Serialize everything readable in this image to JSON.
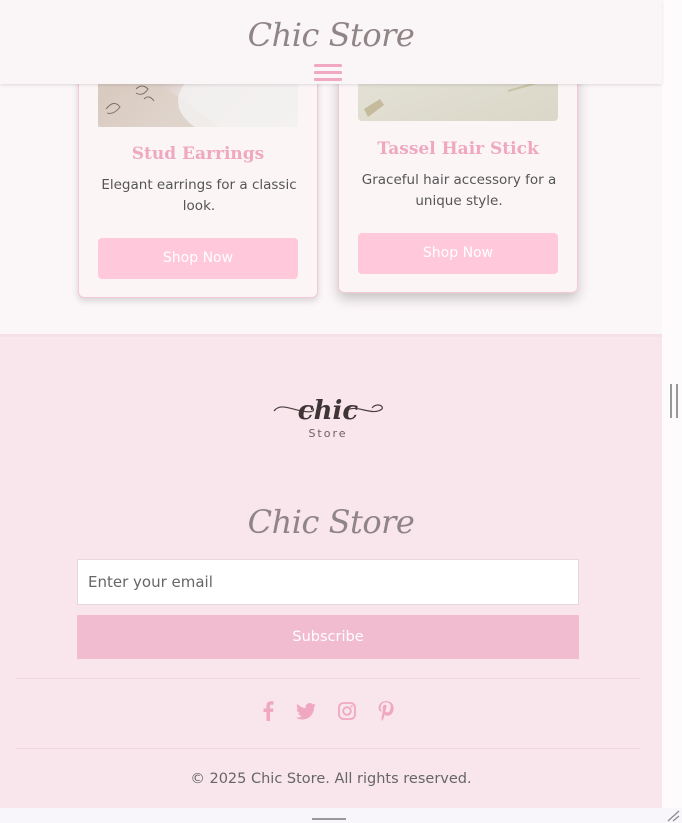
{
  "header": {
    "logo_text": "Chic Store",
    "menu_icon": "hamburger-menu-icon"
  },
  "products": [
    {
      "name": "Stud Earrings",
      "description": "Elegant earrings for a classic look.",
      "button_label": "Shop Now"
    },
    {
      "name": "Tassel Hair Stick",
      "description": "Graceful hair accessory for a unique style.",
      "button_label": "Shop Now"
    }
  ],
  "footer": {
    "logo_script": "chic",
    "logo_sub": "Store",
    "brand_text": "Chic Store",
    "email_placeholder": "Enter your email",
    "subscribe_label": "Subscribe",
    "socials": [
      "facebook-icon",
      "twitter-icon",
      "instagram-icon",
      "pinterest-icon"
    ],
    "copyright": "© 2025 Chic Store. All rights reserved."
  },
  "colors": {
    "accent_pink": "#f1bcd0",
    "button_pink": "#ffc9db",
    "title_pink": "#efa8c0",
    "footer_bg": "#f8e6ec"
  }
}
